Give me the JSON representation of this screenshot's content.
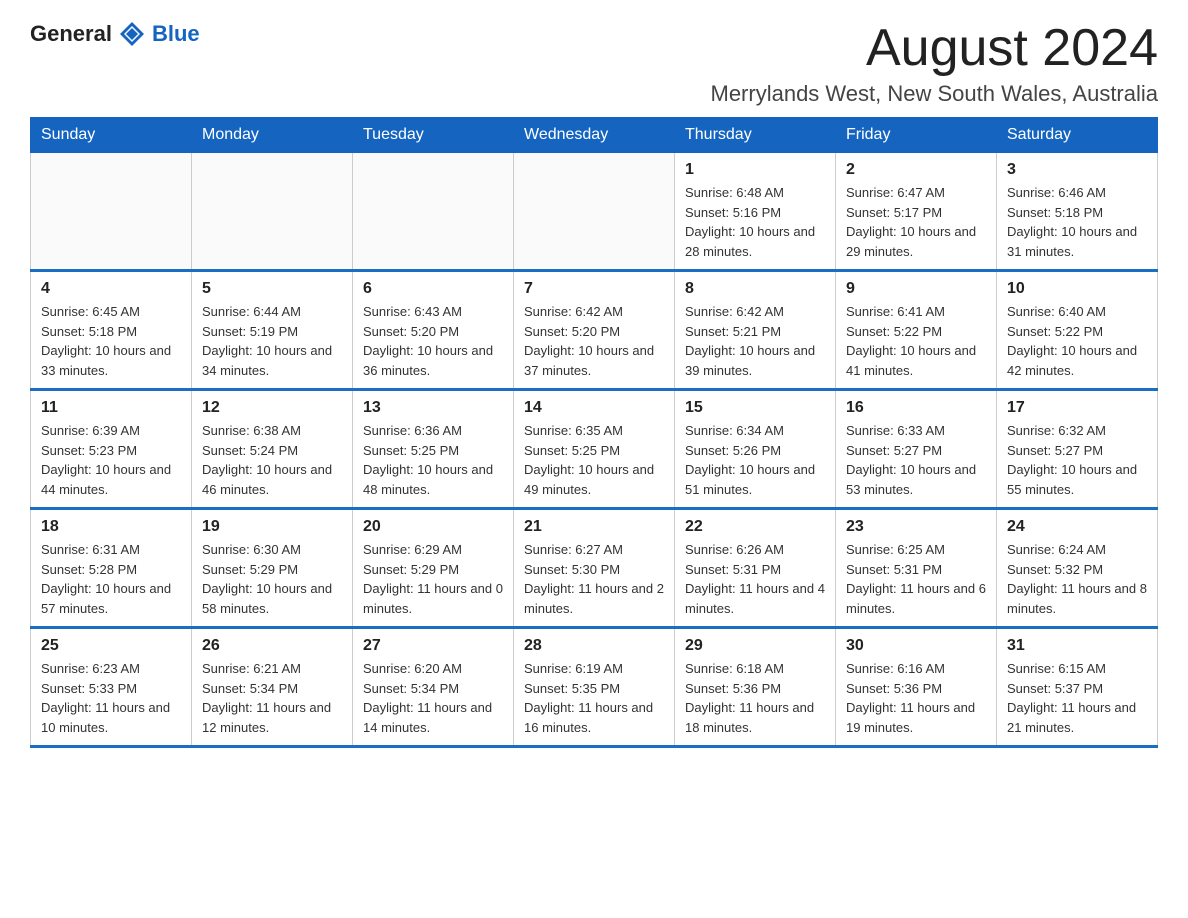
{
  "logo": {
    "text_general": "General",
    "text_blue": "Blue"
  },
  "header": {
    "month_title": "August 2024",
    "location": "Merrylands West, New South Wales, Australia"
  },
  "days_of_week": [
    "Sunday",
    "Monday",
    "Tuesday",
    "Wednesday",
    "Thursday",
    "Friday",
    "Saturday"
  ],
  "weeks": [
    [
      {
        "day": "",
        "info": ""
      },
      {
        "day": "",
        "info": ""
      },
      {
        "day": "",
        "info": ""
      },
      {
        "day": "",
        "info": ""
      },
      {
        "day": "1",
        "info": "Sunrise: 6:48 AM\nSunset: 5:16 PM\nDaylight: 10 hours and 28 minutes."
      },
      {
        "day": "2",
        "info": "Sunrise: 6:47 AM\nSunset: 5:17 PM\nDaylight: 10 hours and 29 minutes."
      },
      {
        "day": "3",
        "info": "Sunrise: 6:46 AM\nSunset: 5:18 PM\nDaylight: 10 hours and 31 minutes."
      }
    ],
    [
      {
        "day": "4",
        "info": "Sunrise: 6:45 AM\nSunset: 5:18 PM\nDaylight: 10 hours and 33 minutes."
      },
      {
        "day": "5",
        "info": "Sunrise: 6:44 AM\nSunset: 5:19 PM\nDaylight: 10 hours and 34 minutes."
      },
      {
        "day": "6",
        "info": "Sunrise: 6:43 AM\nSunset: 5:20 PM\nDaylight: 10 hours and 36 minutes."
      },
      {
        "day": "7",
        "info": "Sunrise: 6:42 AM\nSunset: 5:20 PM\nDaylight: 10 hours and 37 minutes."
      },
      {
        "day": "8",
        "info": "Sunrise: 6:42 AM\nSunset: 5:21 PM\nDaylight: 10 hours and 39 minutes."
      },
      {
        "day": "9",
        "info": "Sunrise: 6:41 AM\nSunset: 5:22 PM\nDaylight: 10 hours and 41 minutes."
      },
      {
        "day": "10",
        "info": "Sunrise: 6:40 AM\nSunset: 5:22 PM\nDaylight: 10 hours and 42 minutes."
      }
    ],
    [
      {
        "day": "11",
        "info": "Sunrise: 6:39 AM\nSunset: 5:23 PM\nDaylight: 10 hours and 44 minutes."
      },
      {
        "day": "12",
        "info": "Sunrise: 6:38 AM\nSunset: 5:24 PM\nDaylight: 10 hours and 46 minutes."
      },
      {
        "day": "13",
        "info": "Sunrise: 6:36 AM\nSunset: 5:25 PM\nDaylight: 10 hours and 48 minutes."
      },
      {
        "day": "14",
        "info": "Sunrise: 6:35 AM\nSunset: 5:25 PM\nDaylight: 10 hours and 49 minutes."
      },
      {
        "day": "15",
        "info": "Sunrise: 6:34 AM\nSunset: 5:26 PM\nDaylight: 10 hours and 51 minutes."
      },
      {
        "day": "16",
        "info": "Sunrise: 6:33 AM\nSunset: 5:27 PM\nDaylight: 10 hours and 53 minutes."
      },
      {
        "day": "17",
        "info": "Sunrise: 6:32 AM\nSunset: 5:27 PM\nDaylight: 10 hours and 55 minutes."
      }
    ],
    [
      {
        "day": "18",
        "info": "Sunrise: 6:31 AM\nSunset: 5:28 PM\nDaylight: 10 hours and 57 minutes."
      },
      {
        "day": "19",
        "info": "Sunrise: 6:30 AM\nSunset: 5:29 PM\nDaylight: 10 hours and 58 minutes."
      },
      {
        "day": "20",
        "info": "Sunrise: 6:29 AM\nSunset: 5:29 PM\nDaylight: 11 hours and 0 minutes."
      },
      {
        "day": "21",
        "info": "Sunrise: 6:27 AM\nSunset: 5:30 PM\nDaylight: 11 hours and 2 minutes."
      },
      {
        "day": "22",
        "info": "Sunrise: 6:26 AM\nSunset: 5:31 PM\nDaylight: 11 hours and 4 minutes."
      },
      {
        "day": "23",
        "info": "Sunrise: 6:25 AM\nSunset: 5:31 PM\nDaylight: 11 hours and 6 minutes."
      },
      {
        "day": "24",
        "info": "Sunrise: 6:24 AM\nSunset: 5:32 PM\nDaylight: 11 hours and 8 minutes."
      }
    ],
    [
      {
        "day": "25",
        "info": "Sunrise: 6:23 AM\nSunset: 5:33 PM\nDaylight: 11 hours and 10 minutes."
      },
      {
        "day": "26",
        "info": "Sunrise: 6:21 AM\nSunset: 5:34 PM\nDaylight: 11 hours and 12 minutes."
      },
      {
        "day": "27",
        "info": "Sunrise: 6:20 AM\nSunset: 5:34 PM\nDaylight: 11 hours and 14 minutes."
      },
      {
        "day": "28",
        "info": "Sunrise: 6:19 AM\nSunset: 5:35 PM\nDaylight: 11 hours and 16 minutes."
      },
      {
        "day": "29",
        "info": "Sunrise: 6:18 AM\nSunset: 5:36 PM\nDaylight: 11 hours and 18 minutes."
      },
      {
        "day": "30",
        "info": "Sunrise: 6:16 AM\nSunset: 5:36 PM\nDaylight: 11 hours and 19 minutes."
      },
      {
        "day": "31",
        "info": "Sunrise: 6:15 AM\nSunset: 5:37 PM\nDaylight: 11 hours and 21 minutes."
      }
    ]
  ]
}
